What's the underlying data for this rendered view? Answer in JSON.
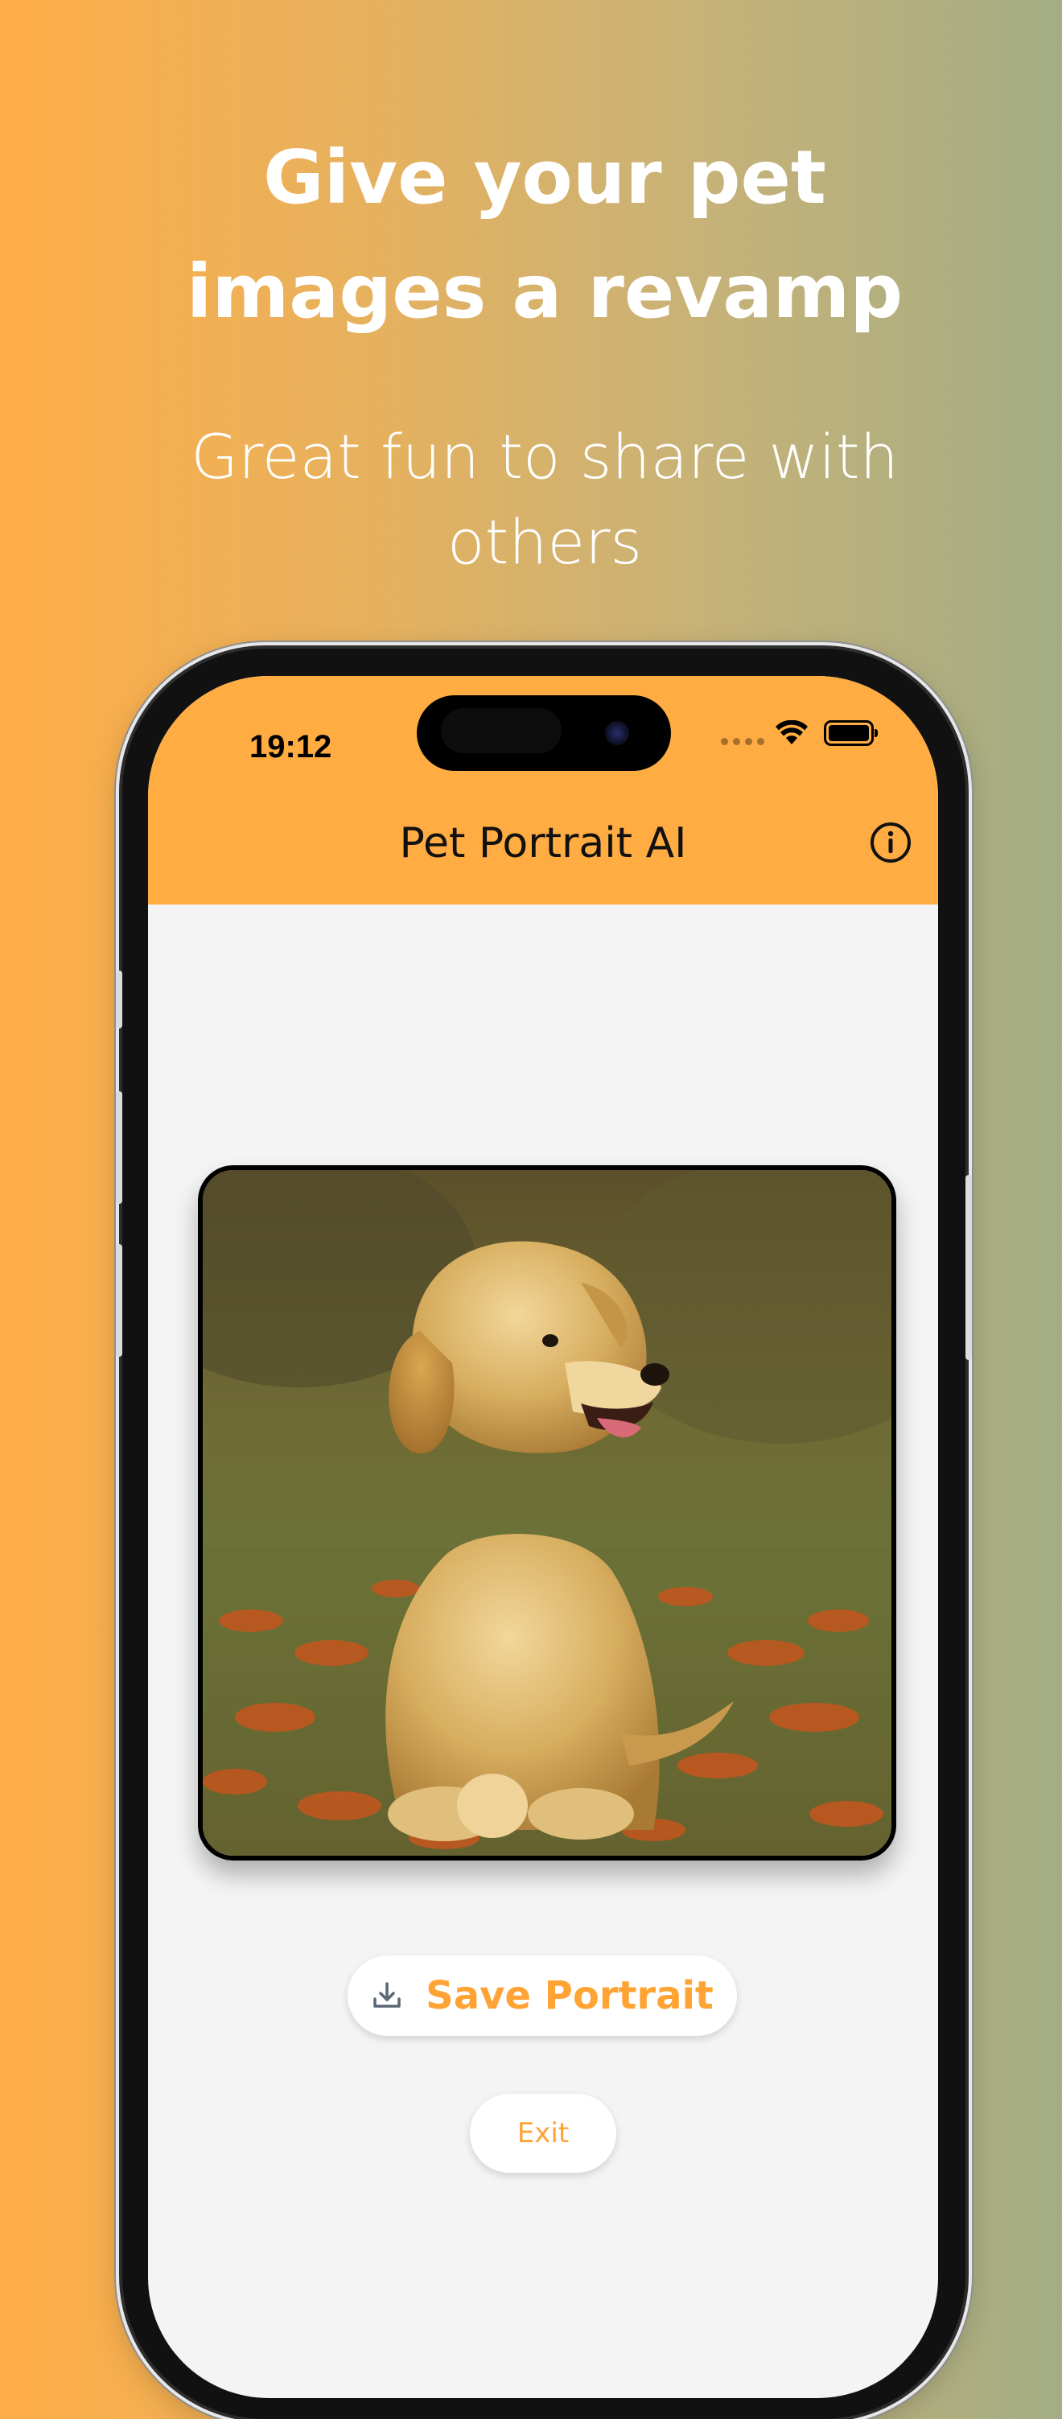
{
  "promo": {
    "headline_line1": "Give your pet",
    "headline_line2": "images a revamp",
    "subheadline_line1": "Great fun to share with",
    "subheadline_line2": "others"
  },
  "status_bar": {
    "time": "19:12"
  },
  "header": {
    "title": "Pet Portrait AI",
    "info_icon": "info-circle-icon"
  },
  "portrait": {
    "subject": "golden retriever puppy oil painting"
  },
  "actions": {
    "save_label": "Save Portrait",
    "save_icon": "download-icon",
    "exit_label": "Exit"
  },
  "colors": {
    "accent": "#ffac43",
    "button_text": "#ffa434",
    "screen_bg": "#f4f4f4"
  }
}
